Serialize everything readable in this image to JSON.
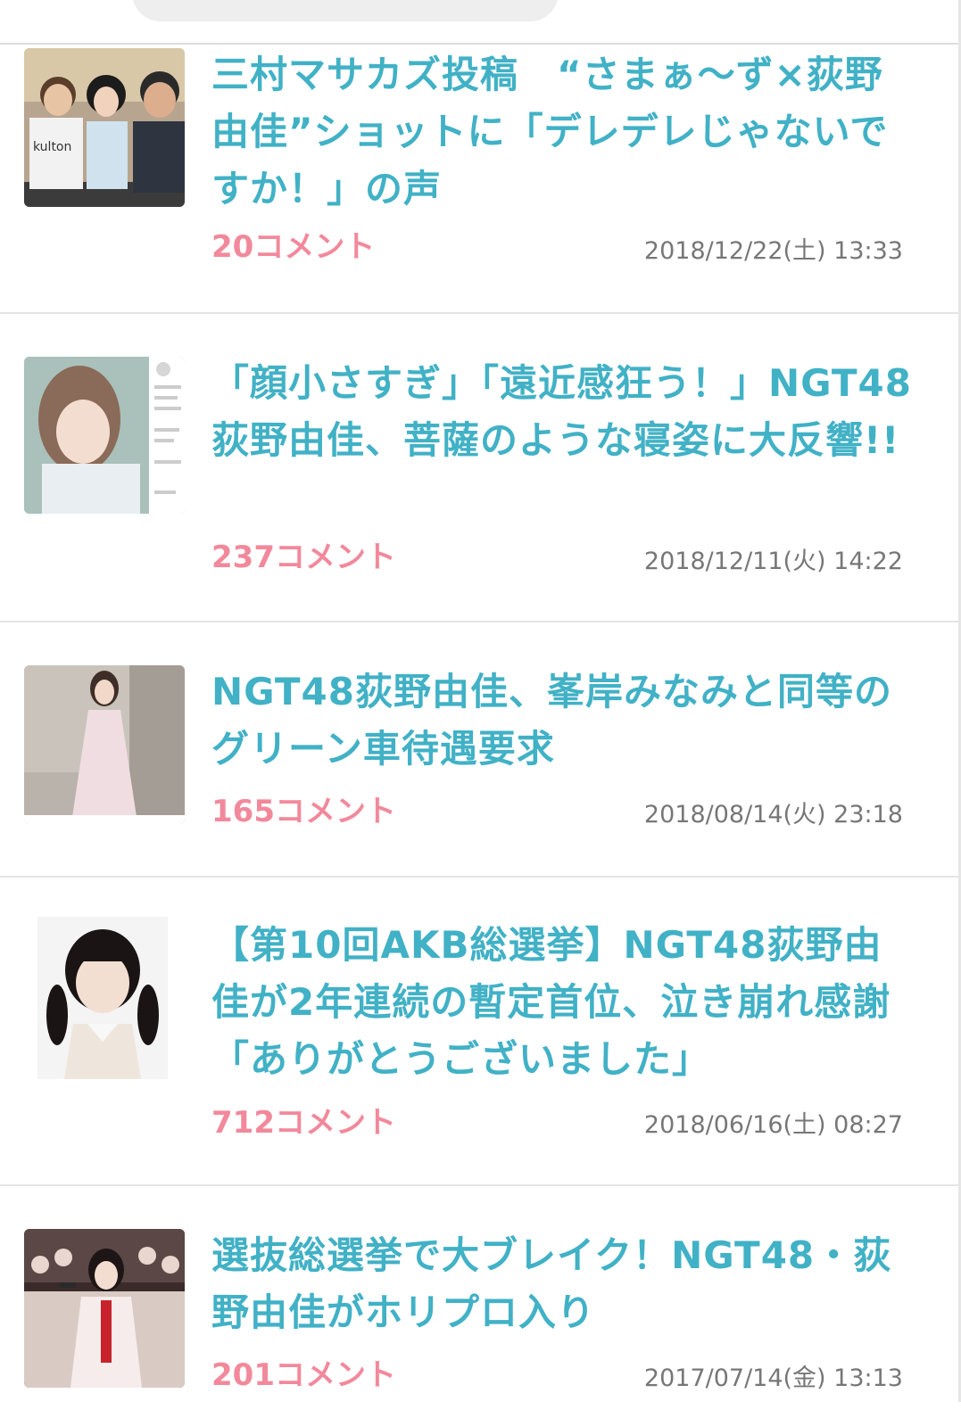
{
  "colors": {
    "title": "#41b1c6",
    "comments": "#f2899b",
    "date": "#777777",
    "divider": "#e4e4e4"
  },
  "articles": [
    {
      "title": "三村マサカズ投稿　“さまぁ〜ず×荻野由佳”ショットに「デレデレじゃないですか！」の声",
      "comments": "20コメント",
      "date": "2018/12/22(土) 13:33",
      "thumbnail": "group-photo"
    },
    {
      "title": "「顔小さすぎ」「遠近感狂う！」NGT48荻野由佳、菩薩のような寝姿に大反響!!",
      "comments": "237コメント",
      "date": "2018/12/11(火) 14:22",
      "thumbnail": "sleeping-photo"
    },
    {
      "title": "NGT48荻野由佳、峯岸みなみと同等のグリーン車待遇要求",
      "comments": "165コメント",
      "date": "2018/08/14(火) 23:18",
      "thumbnail": "dress-photo"
    },
    {
      "title": "【第10回AKB総選挙】NGT48荻野由佳が2年連続の暫定首位、泣き崩れ感謝「ありがとうございました」",
      "comments": "712コメント",
      "date": "2018/06/16(土) 08:27",
      "thumbnail": "portrait-photo"
    },
    {
      "title": "選抜総選挙で大ブレイク！NGT48・荻野由佳がホリプロ入り",
      "comments": "201コメント",
      "date": "2017/07/14(金) 13:13",
      "thumbnail": "stage-photo"
    }
  ]
}
